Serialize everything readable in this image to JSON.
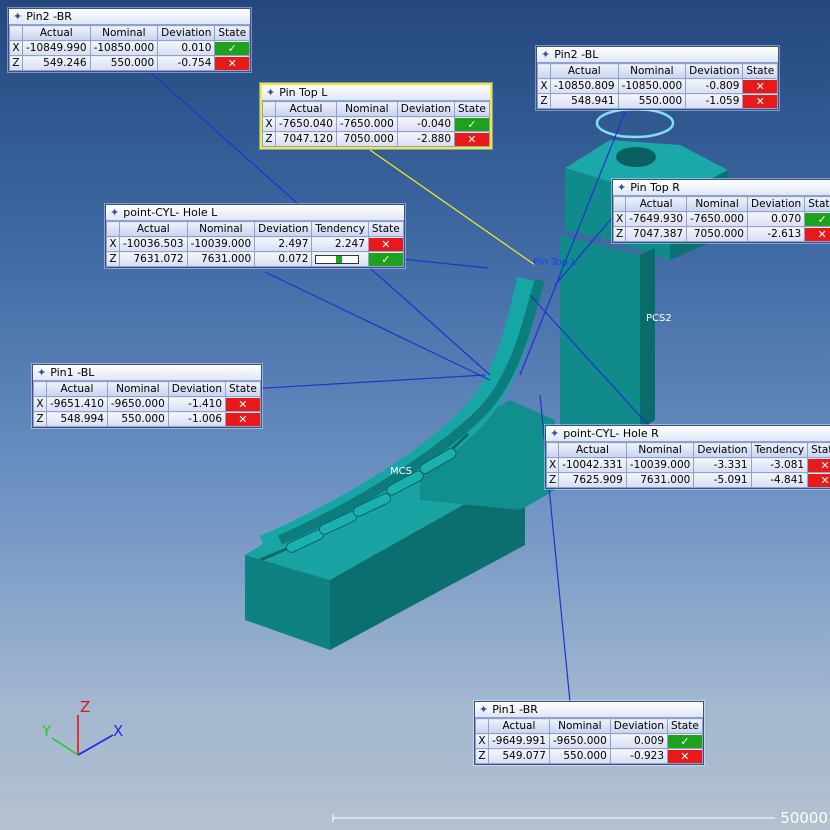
{
  "panels": {
    "pin2_br": {
      "title": "Pin2 -BR",
      "headers": [
        "Actual",
        "Nominal",
        "Deviation",
        "State"
      ],
      "rows": [
        {
          "axis": "X",
          "actual": "-10849.990",
          "nominal": "-10850.000",
          "deviation": "0.010",
          "state": "ok"
        },
        {
          "axis": "Z",
          "actual": "549.246",
          "nominal": "550.000",
          "deviation": "-0.754",
          "state": "bad"
        }
      ]
    },
    "pin2_bl": {
      "title": "Pin2 -BL",
      "headers": [
        "Actual",
        "Nominal",
        "Deviation",
        "State"
      ],
      "rows": [
        {
          "axis": "X",
          "actual": "-10850.809",
          "nominal": "-10850.000",
          "deviation": "-0.809",
          "state": "bad"
        },
        {
          "axis": "Z",
          "actual": "548.941",
          "nominal": "550.000",
          "deviation": "-1.059",
          "state": "bad"
        }
      ]
    },
    "pin_top_l": {
      "title": "Pin Top L",
      "headers": [
        "Actual",
        "Nominal",
        "Deviation",
        "State"
      ],
      "rows": [
        {
          "axis": "X",
          "actual": "-7650.040",
          "nominal": "-7650.000",
          "deviation": "-0.040",
          "state": "ok"
        },
        {
          "axis": "Z",
          "actual": "7047.120",
          "nominal": "7050.000",
          "deviation": "-2.880",
          "state": "bad"
        }
      ]
    },
    "pin_top_r": {
      "title": "Pin Top R",
      "headers": [
        "Actual",
        "Nominal",
        "Deviation",
        "State"
      ],
      "rows": [
        {
          "axis": "X",
          "actual": "-7649.930",
          "nominal": "-7650.000",
          "deviation": "0.070",
          "state": "ok"
        },
        {
          "axis": "Z",
          "actual": "7047.387",
          "nominal": "7050.000",
          "deviation": "-2.613",
          "state": "bad"
        }
      ]
    },
    "cyl_hole_l": {
      "title": "point-CYL- Hole L",
      "headers": [
        "Actual",
        "Nominal",
        "Deviation",
        "Tendency",
        "State"
      ],
      "rows": [
        {
          "axis": "X",
          "actual": "-10036.503",
          "nominal": "-10039.000",
          "deviation": "2.497",
          "tendency": "2.247",
          "state": "bad"
        },
        {
          "axis": "Z",
          "actual": "7631.072",
          "nominal": "7631.000",
          "deviation": "0.072",
          "tendency": "",
          "state": "ok",
          "tendency_bar": true
        }
      ]
    },
    "pin1_bl": {
      "title": "Pin1 -BL",
      "headers": [
        "Actual",
        "Nominal",
        "Deviation",
        "State"
      ],
      "rows": [
        {
          "axis": "X",
          "actual": "-9651.410",
          "nominal": "-9650.000",
          "deviation": "-1.410",
          "state": "bad"
        },
        {
          "axis": "Z",
          "actual": "548.994",
          "nominal": "550.000",
          "deviation": "-1.006",
          "state": "bad"
        }
      ]
    },
    "cyl_hole_r": {
      "title": "point-CYL- Hole R",
      "headers": [
        "Actual",
        "Nominal",
        "Deviation",
        "Tendency",
        "State"
      ],
      "rows": [
        {
          "axis": "X",
          "actual": "-10042.331",
          "nominal": "-10039.000",
          "deviation": "-3.331",
          "tendency": "-3.081",
          "state": "bad"
        },
        {
          "axis": "Z",
          "actual": "7625.909",
          "nominal": "7631.000",
          "deviation": "-5.091",
          "tendency": "-4.841",
          "state": "bad"
        }
      ]
    },
    "pin1_br": {
      "title": "Pin1 -BR",
      "headers": [
        "Actual",
        "Nominal",
        "Deviation",
        "State"
      ],
      "rows": [
        {
          "axis": "X",
          "actual": "-9649.991",
          "nominal": "-9650.000",
          "deviation": "0.009",
          "state": "ok"
        },
        {
          "axis": "Z",
          "actual": "549.077",
          "nominal": "550.000",
          "deviation": "-0.923",
          "state": "bad"
        }
      ]
    }
  },
  "scene_labels": {
    "pin_top_l": "Pin Top L",
    "pcs": "PCS2",
    "mcs": "MCS"
  },
  "triad": {
    "x": "X",
    "y": "Y",
    "z": "Z"
  },
  "scale": "50000",
  "icons": {
    "title": "pin-icon",
    "ok": "check-icon",
    "bad": "cross-icon"
  },
  "colors": {
    "ok": "#1ea21e",
    "bad": "#e81919",
    "selected": "#f2ea2a",
    "model": "#0f8a8a",
    "leader": "#1f33cc"
  }
}
